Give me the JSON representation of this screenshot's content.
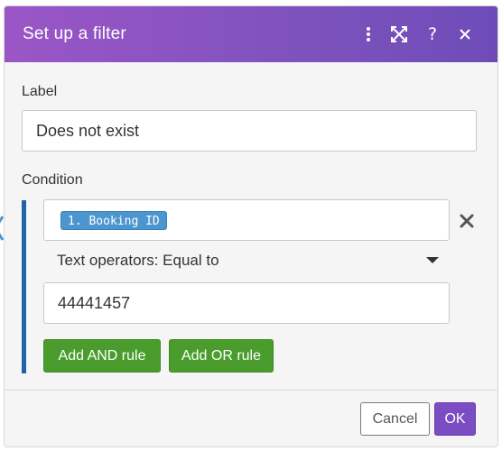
{
  "dialog": {
    "title": "Set up a filter",
    "header_icons": [
      "kebab-menu-icon",
      "expand-icon",
      "help-icon",
      "close-icon"
    ],
    "help_glyph": "?"
  },
  "label_field": {
    "label": "Label",
    "value": "Does not exist"
  },
  "condition": {
    "label": "Condition",
    "operand_pill": "1. Booking ID",
    "operator": "Text operators: Equal to",
    "value": "44441457",
    "add_and_label": "Add AND rule",
    "add_or_label": "Add OR rule"
  },
  "footer": {
    "cancel_label": "Cancel",
    "ok_label": "OK"
  },
  "colors": {
    "header_gradient_start": "#9b56c6",
    "header_gradient_end": "#6e4cb8",
    "condition_bar": "#2162a8",
    "pill": "#4c96cf",
    "green_button": "#4a9d2d",
    "ok_button": "#7b4cc2"
  }
}
